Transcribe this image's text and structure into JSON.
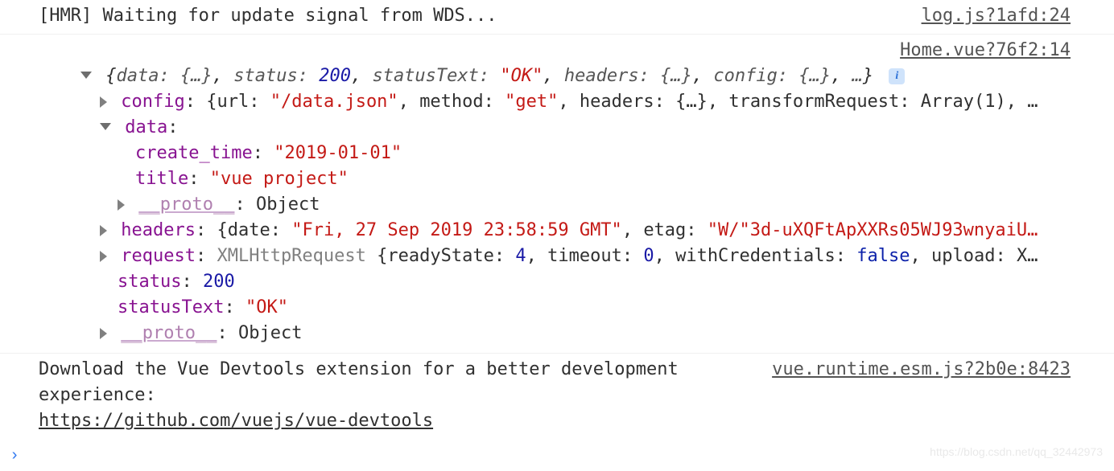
{
  "entries": {
    "hmr": {
      "text": "[HMR] Waiting for update signal from WDS...",
      "source": "log.js?1afd:24"
    },
    "object": {
      "source": "Home.vue?76f2:14",
      "summary": {
        "data_label": "data:",
        "data_val": "{…}",
        "status_label": "status:",
        "status_val": "200",
        "statusText_label": "statusText:",
        "statusText_val": "\"OK\"",
        "headers_label": "headers:",
        "headers_val": "{…}",
        "config_label": "config:",
        "config_val": "{…}",
        "more": "…"
      },
      "config_line": {
        "key": "config",
        "url_k": "url",
        "url_v": "\"/data.json\"",
        "method_k": "method",
        "method_v": "\"get\"",
        "headers_k": "headers",
        "headers_v": "{…}",
        "tr_k": "transformRequest",
        "tr_v": "Array(1)",
        "more": "…"
      },
      "data_line": {
        "key": "data",
        "colon": ":"
      },
      "create_time": {
        "key": "create_time",
        "val": "\"2019-01-01\""
      },
      "title": {
        "key": "title",
        "val": "\"vue project\""
      },
      "proto1": {
        "key": "__proto__",
        "val": "Object"
      },
      "headers_line": {
        "key": "headers",
        "date_k": "date",
        "date_v": "\"Fri, 27 Sep 2019 23:58:59 GMT\"",
        "etag_k": "etag",
        "etag_v": "\"W/\"3d-uXQFtApXXRs05WJ93wnyaiU…"
      },
      "request_line": {
        "key": "request",
        "type": "XMLHttpRequest",
        "rs_k": "readyState",
        "rs_v": "4",
        "to_k": "timeout",
        "to_v": "0",
        "wc_k": "withCredentials",
        "wc_v": "false",
        "up_k": "upload",
        "up_v": "X…"
      },
      "status": {
        "key": "status",
        "val": "200"
      },
      "statusText": {
        "key": "statusText",
        "val": "\"OK\""
      },
      "proto2": {
        "key": "__proto__",
        "val": "Object"
      }
    },
    "devtools": {
      "text_a": "Download the Vue Devtools extension for a better development",
      "text_b": "experience:",
      "link": "https://github.com/vuejs/vue-devtools",
      "source": "vue.runtime.esm.js?2b0e:8423"
    }
  },
  "ui": {
    "prompt": "›"
  },
  "watermark": "https://blog.csdn.net/qq_32442973"
}
